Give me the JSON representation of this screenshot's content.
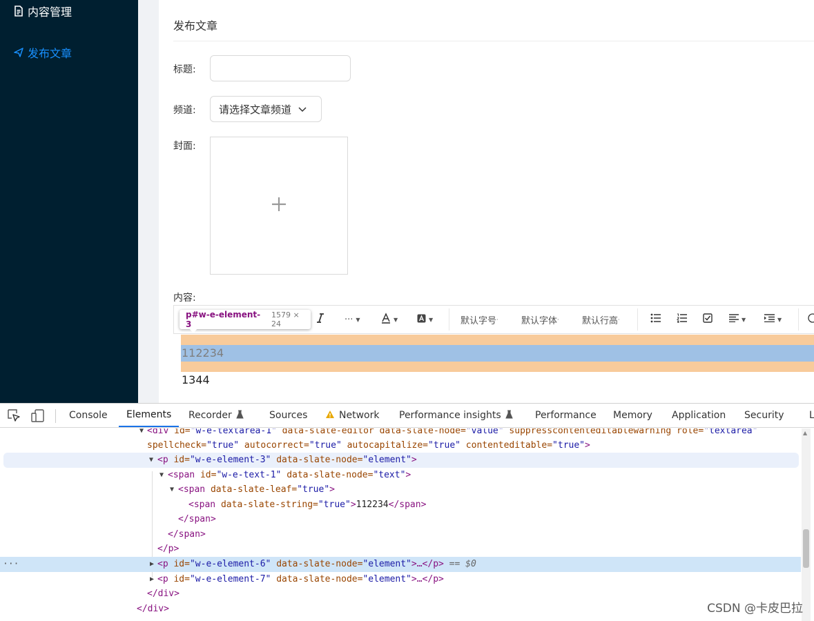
{
  "sidebar": {
    "items": [
      {
        "label": "内容管理",
        "icon": "document-icon"
      },
      {
        "label": "发布文章",
        "icon": "send-icon"
      }
    ],
    "active_color": "#1890ff",
    "background": "#001f30"
  },
  "form": {
    "card_title": "发布文章",
    "title_label": "标题:",
    "title_value": "",
    "channel_label": "频道:",
    "channel_placeholder": "请选择文章频道",
    "cover_label": "封面:",
    "content_label": "内容:"
  },
  "editor": {
    "toolbar": {
      "italic": "I",
      "more": "···",
      "font_size": "默认字号",
      "font_family": "默认字体",
      "line_height": "默认行高"
    },
    "tooltip": {
      "selector": "p#w-e-element-3",
      "size": "1579 × 24"
    },
    "paragraphs": [
      "112234",
      "1344"
    ]
  },
  "devtools": {
    "tabs": [
      {
        "label": "Console"
      },
      {
        "label": "Elements",
        "active": true
      },
      {
        "label": "Recorder",
        "icon": "flask-icon"
      },
      {
        "label": "Sources"
      },
      {
        "label": "Network",
        "icon": "warning-icon"
      },
      {
        "label": "Performance insights",
        "icon": "flask-icon"
      },
      {
        "label": "Performance"
      },
      {
        "label": "Memory"
      },
      {
        "label": "Application"
      },
      {
        "label": "Security"
      },
      {
        "label": "L"
      }
    ],
    "dom": {
      "l0_tag": "<div",
      "l0_a1": " id=",
      "l0_v1": "\"w-e-textarea-1\"",
      "l0_a2": " data-slate-editor data-slate-node=",
      "l0_v2": "\"value\"",
      "l0_a3": " suppresscontenteditablewarning role=",
      "l0_v3": "\"textarea\"",
      "l1_a1": "spellcheck=",
      "l1_v1": "\"true\"",
      "l1_a2": " autocorrect=",
      "l1_v2": "\"true\"",
      "l1_a3": " autocapitalize=",
      "l1_v3": "\"true\"",
      "l1_a4": " contenteditable=",
      "l1_v4": "\"true\"",
      "l1_end": ">",
      "l2_tag": "<p",
      "l2_a1": " id=",
      "l2_v1": "\"w-e-element-3\"",
      "l2_a2": " data-slate-node=",
      "l2_v2": "\"element\"",
      "l2_end": ">",
      "l3_tag": "<span",
      "l3_a1": " id=",
      "l3_v1": "\"w-e-text-1\"",
      "l3_a2": " data-slate-node=",
      "l3_v2": "\"text\"",
      "l3_end": ">",
      "l4_tag": "<span",
      "l4_a1": " data-slate-leaf=",
      "l4_v1": "\"true\"",
      "l4_end": ">",
      "l5_tag": "<span",
      "l5_a1": " data-slate-string=",
      "l5_v1": "\"true\"",
      "l5_end": ">",
      "l5_text": "112234",
      "l5_close": "</span>",
      "l6": "</span>",
      "l7": "</span>",
      "l8": "</p>",
      "l9_tag": "<p",
      "l9_a1": " id=",
      "l9_v1": "\"w-e-element-6\"",
      "l9_a2": " data-slate-node=",
      "l9_v2": "\"element\"",
      "l9_end": ">…</p>",
      "l9_ref": " == $0",
      "l10_tag": "<p",
      "l10_a1": " id=",
      "l10_v1": "\"w-e-element-7\"",
      "l10_a2": " data-slate-node=",
      "l10_v2": "\"element\"",
      "l10_end": ">…</p>",
      "l11": "</div>",
      "l12": "</div>",
      "row_menu": "···"
    }
  },
  "watermark": "CSDN @卡皮巴拉"
}
